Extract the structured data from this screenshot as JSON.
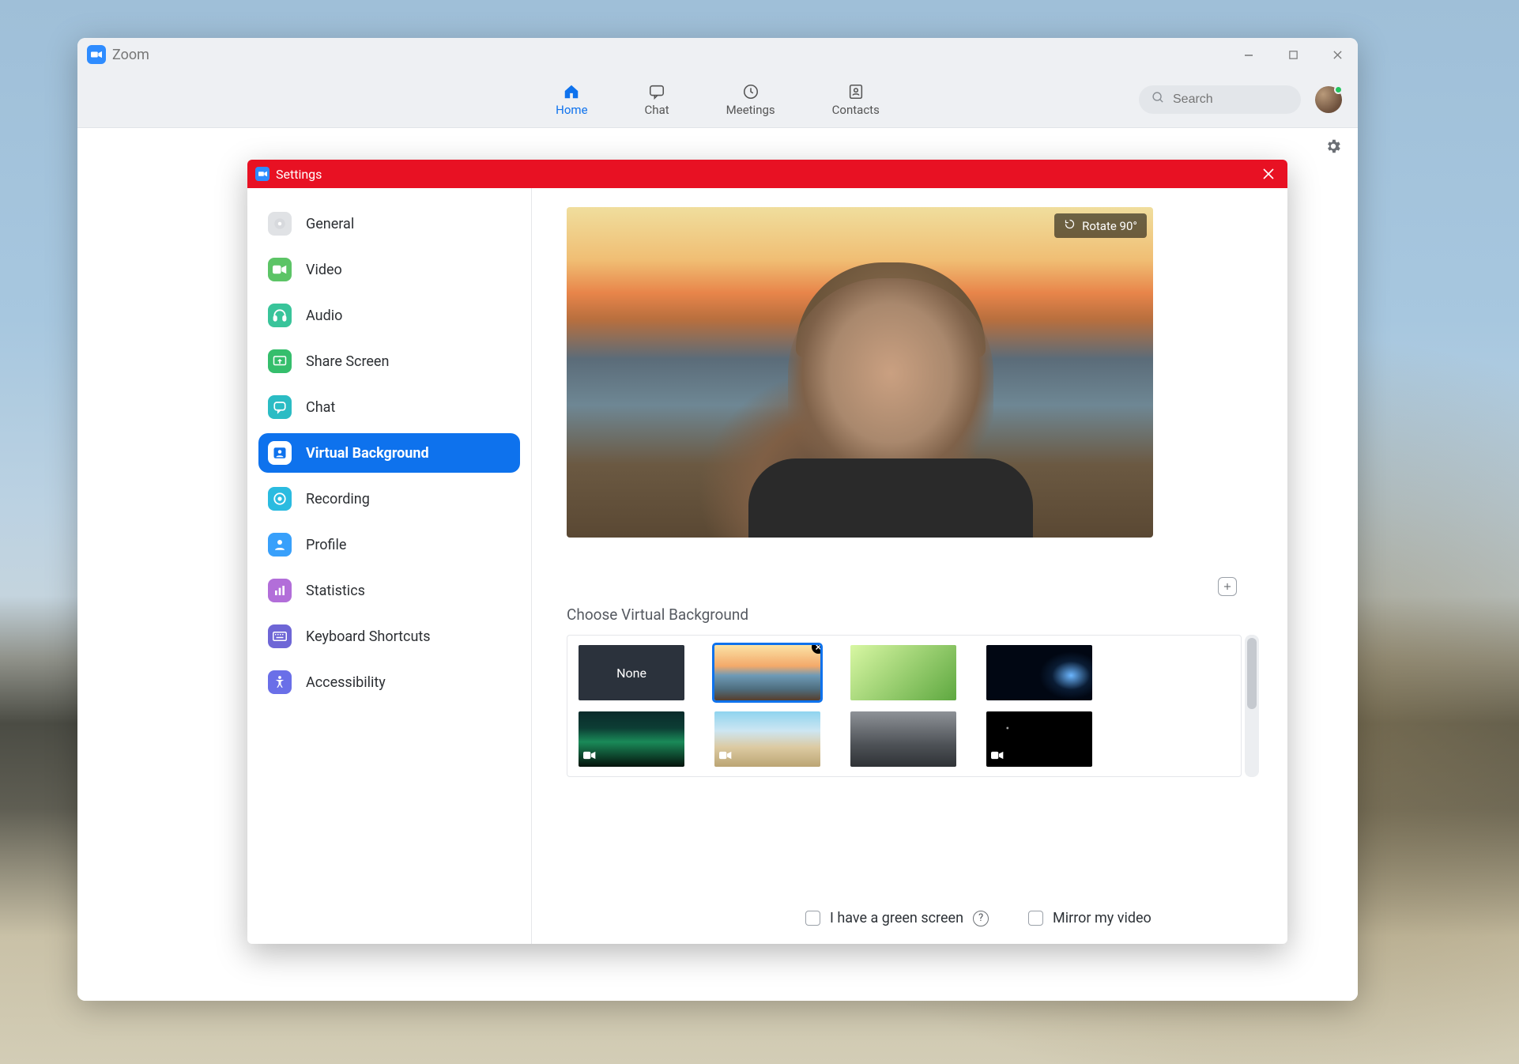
{
  "app": {
    "title": "Zoom"
  },
  "window_controls": {
    "minimize": "–",
    "maximize": "▢",
    "close": "×"
  },
  "nav": {
    "home": "Home",
    "chat": "Chat",
    "meetings": "Meetings",
    "contacts": "Contacts",
    "search_placeholder": "Search"
  },
  "settings": {
    "title": "Settings",
    "rotate_label": "Rotate 90°",
    "section_title": "Choose Virtual Background",
    "none_label": "None",
    "green_screen_label": "I have a green screen",
    "mirror_label": "Mirror my video",
    "sidebar": {
      "general": "General",
      "video": "Video",
      "audio": "Audio",
      "share_screen": "Share Screen",
      "chat": "Chat",
      "virtual_background": "Virtual Background",
      "recording": "Recording",
      "profile": "Profile",
      "statistics": "Statistics",
      "keyboard_shortcuts": "Keyboard Shortcuts",
      "accessibility": "Accessibility"
    }
  }
}
